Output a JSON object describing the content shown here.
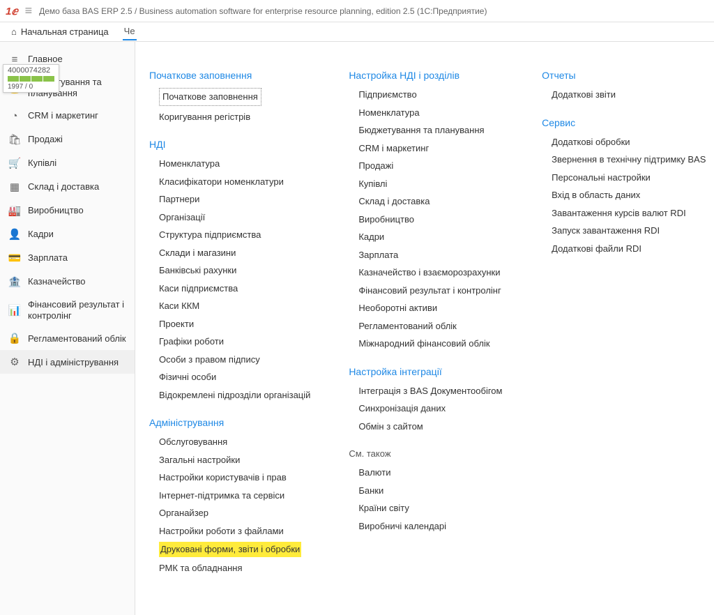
{
  "titlebar": {
    "title": "Демо база BAS ERP 2.5 / Business automation software for enterprise resource planning, edition 2.5  (1С:Предприятие)"
  },
  "tabs": {
    "home": "Начальная страница",
    "partial": "Че"
  },
  "badge": {
    "id": "4000074282",
    "counter": "1997 / 0"
  },
  "sidebar": [
    {
      "icon": "≡",
      "label": "Главное"
    },
    {
      "icon": "💰",
      "label": "Бюджетування та планування"
    },
    {
      "icon": "◔",
      "label": "CRM і маркетинг"
    },
    {
      "icon": "🛍",
      "label": "Продажі"
    },
    {
      "icon": "🛒",
      "label": "Купівлі"
    },
    {
      "icon": "▦",
      "label": "Склад і доставка"
    },
    {
      "icon": "🏭",
      "label": "Виробництво"
    },
    {
      "icon": "👤",
      "label": "Кадри"
    },
    {
      "icon": "💳",
      "label": "Зарплата"
    },
    {
      "icon": "🏦",
      "label": "Казначейство"
    },
    {
      "icon": "📊",
      "label": "Фінансовий результат і контролінг"
    },
    {
      "icon": "🔒",
      "label": "Регламентований облік"
    },
    {
      "icon": "⚙",
      "label": "НДІ і адміністрування"
    }
  ],
  "col1": {
    "s1": {
      "title": "Початкове заповнення",
      "items": [
        "Початкове заповнення",
        "Коригування регістрів"
      ]
    },
    "s2": {
      "title": "НДІ",
      "items": [
        "Номенклатура",
        "Класифікатори номенклатури",
        "Партнери",
        "Організації",
        "Структура підприємства",
        "Склади і магазини",
        "Банківські рахунки",
        "Каси підприємства",
        "Каси ККМ",
        "Проекти",
        "Графіки роботи",
        "Особи з правом підпису",
        "Фізичні особи",
        "Відокремлені підрозділи організацій"
      ]
    },
    "s3": {
      "title": "Адміністрування",
      "items": [
        "Обслуговування",
        "Загальні настройки",
        "Настройки користувачів і прав",
        "Інтернет-підтримка та сервіси",
        "Органайзер",
        "Настройки роботи з файлами",
        "Друковані форми, звіти і обробки",
        "РМК та обладнання"
      ]
    }
  },
  "col2": {
    "s1": {
      "title": "Настройка НДІ і розділів",
      "items": [
        "Підприємство",
        "Номенклатура",
        "Бюджетування та планування",
        "CRM і маркетинг",
        "Продажі",
        "Купівлі",
        "Склад і доставка",
        "Виробництво",
        "Кадри",
        "Зарплата",
        "Казначейство і взаєморозрахунки",
        "Фінансовий результат і контролінг",
        "Необоротні активи",
        "Регламентований облік",
        "Міжнародний фінансовий облік"
      ]
    },
    "s2": {
      "title": "Настройка інтеграції",
      "items": [
        "Інтеграція з BAS Документообігом",
        "Синхронізація даних",
        "Обмін з сайтом"
      ]
    },
    "s3": {
      "title": "См. також",
      "items": [
        "Валюти",
        "Банки",
        "Країни світу",
        "Виробничі календарі"
      ]
    }
  },
  "col3": {
    "s1": {
      "title": "Отчеты",
      "items": [
        "Додаткові звіти"
      ]
    },
    "s2": {
      "title": "Сервис",
      "items": [
        "Додаткові обробки",
        "Звернення в технічну підтримку BAS",
        "Персональні настройки",
        "Вхід в область даних",
        "Завантаження курсів валют RDI",
        "Запуск завантаження RDI",
        "Додаткові файли RDI"
      ]
    }
  }
}
